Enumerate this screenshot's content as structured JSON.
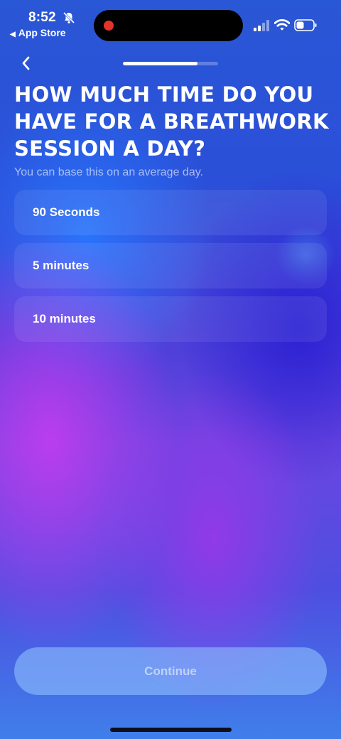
{
  "status_bar": {
    "time": "8:52",
    "back_app": "App Store",
    "back_arrow": "◀",
    "icons": [
      "bell-slash-icon",
      "signal-icon",
      "wifi-icon",
      "battery-icon"
    ]
  },
  "nav": {
    "back_icon": "chevron-left-icon",
    "progress": 0.78
  },
  "question": {
    "title": "How much time do you have for a breathwork session a day?",
    "subtitle": "You can base this on an average day."
  },
  "options": [
    {
      "label": "90 Seconds"
    },
    {
      "label": "5 minutes"
    },
    {
      "label": "10 minutes"
    }
  ],
  "footer": {
    "continue_label": "Continue"
  },
  "colors": {
    "background_top": "#2a57d6",
    "background_mid": "#6b45e0",
    "accent_purple": "#c83cf0",
    "recording_dot": "#e5332a"
  }
}
